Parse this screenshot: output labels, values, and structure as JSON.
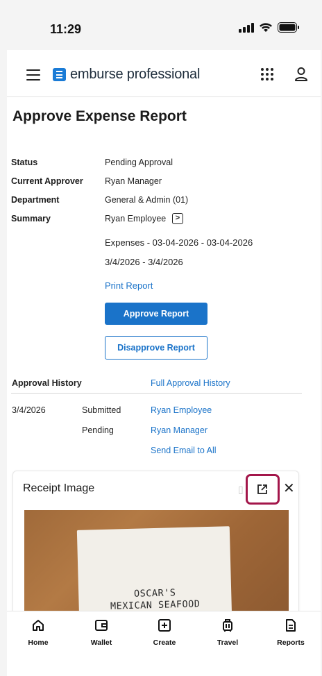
{
  "status_bar": {
    "time": "11:29"
  },
  "header": {
    "logo_text": "emburse professional"
  },
  "page": {
    "title": "Approve Expense Report"
  },
  "details": {
    "status_label": "Status",
    "status_value": "Pending Approval",
    "approver_label": "Current Approver",
    "approver_value": "Ryan Manager",
    "department_label": "Department",
    "department_value": "General & Admin (01)",
    "summary_label": "Summary",
    "summary_value": "Ryan Employee",
    "expenses_line": "Expenses - 03-04-2026 - 03-04-2026",
    "date_range": "3/4/2026 - 3/4/2026"
  },
  "actions": {
    "print_report": "Print Report",
    "approve": "Approve Report",
    "disapprove": "Disapprove Report"
  },
  "approval_history": {
    "label": "Approval History",
    "full_link": "Full Approval History",
    "rows": [
      {
        "date": "3/4/2026",
        "status": "Submitted",
        "person": "Ryan Employee"
      },
      {
        "date": "",
        "status": "Pending",
        "person": "Ryan Manager"
      }
    ],
    "send_email": "Send Email to All"
  },
  "receipt": {
    "title": "Receipt Image",
    "receipt_lines": [
      "OSCAR'S",
      "MEXICAN SEAFOOD"
    ]
  },
  "bottom_nav": [
    {
      "label": "Home",
      "icon": "home-icon"
    },
    {
      "label": "Wallet",
      "icon": "wallet-icon"
    },
    {
      "label": "Create",
      "icon": "plus-square-icon"
    },
    {
      "label": "Travel",
      "icon": "luggage-icon"
    },
    {
      "label": "Reports",
      "icon": "report-icon"
    }
  ],
  "colors": {
    "accent": "#1a73c9",
    "highlight": "#a3164a"
  }
}
